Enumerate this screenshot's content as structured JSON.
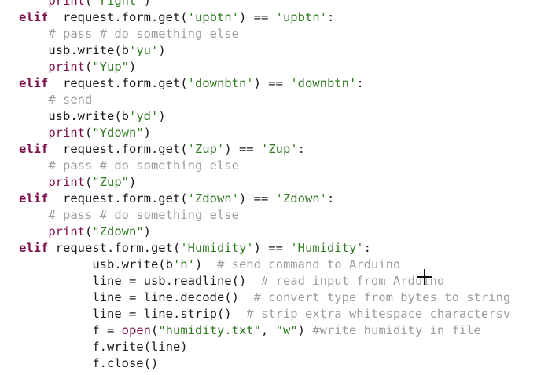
{
  "editor": {
    "lines": [
      {
        "segments": [
          {
            "t": "    "
          },
          {
            "t": "print",
            "c": "bi"
          },
          {
            "t": "("
          },
          {
            "t": "\"right\"",
            "c": "str"
          },
          {
            "t": ")"
          }
        ]
      },
      {
        "segments": [
          {
            "t": "elif",
            "c": "kw"
          },
          {
            "t": "  request.form.get("
          },
          {
            "t": "'upbtn'",
            "c": "str"
          },
          {
            "t": ") == "
          },
          {
            "t": "'upbtn'",
            "c": "str"
          },
          {
            "t": ":"
          }
        ]
      },
      {
        "segments": [
          {
            "t": "    "
          },
          {
            "t": "# pass # do something else",
            "c": "cm"
          }
        ]
      },
      {
        "segments": [
          {
            "t": "    usb.write(b"
          },
          {
            "t": "'yu'",
            "c": "str"
          },
          {
            "t": ")"
          }
        ]
      },
      {
        "segments": [
          {
            "t": "    "
          },
          {
            "t": "print",
            "c": "bi"
          },
          {
            "t": "("
          },
          {
            "t": "\"Yup\"",
            "c": "str"
          },
          {
            "t": ")"
          }
        ]
      },
      {
        "segments": [
          {
            "t": "elif",
            "c": "kw"
          },
          {
            "t": "  request.form.get("
          },
          {
            "t": "'downbtn'",
            "c": "str"
          },
          {
            "t": ") == "
          },
          {
            "t": "'downbtn'",
            "c": "str"
          },
          {
            "t": ":"
          }
        ]
      },
      {
        "segments": [
          {
            "t": "    "
          },
          {
            "t": "# send",
            "c": "cm"
          }
        ]
      },
      {
        "segments": [
          {
            "t": "    usb.write(b"
          },
          {
            "t": "'yd'",
            "c": "str"
          },
          {
            "t": ")"
          }
        ]
      },
      {
        "segments": [
          {
            "t": "    "
          },
          {
            "t": "print",
            "c": "bi"
          },
          {
            "t": "("
          },
          {
            "t": "\"Ydown\"",
            "c": "str"
          },
          {
            "t": ")"
          }
        ]
      },
      {
        "segments": [
          {
            "t": "elif",
            "c": "kw"
          },
          {
            "t": "  request.form.get("
          },
          {
            "t": "'Zup'",
            "c": "str"
          },
          {
            "t": ") == "
          },
          {
            "t": "'Zup'",
            "c": "str"
          },
          {
            "t": ":"
          }
        ]
      },
      {
        "segments": [
          {
            "t": "    "
          },
          {
            "t": "# pass # do something else",
            "c": "cm"
          }
        ]
      },
      {
        "segments": [
          {
            "t": "    "
          },
          {
            "t": "print",
            "c": "bi"
          },
          {
            "t": "("
          },
          {
            "t": "\"Zup\"",
            "c": "str"
          },
          {
            "t": ")"
          }
        ]
      },
      {
        "segments": [
          {
            "t": "elif",
            "c": "kw"
          },
          {
            "t": "  request.form.get("
          },
          {
            "t": "'Zdown'",
            "c": "str"
          },
          {
            "t": ") == "
          },
          {
            "t": "'Zdown'",
            "c": "str"
          },
          {
            "t": ":"
          }
        ]
      },
      {
        "segments": [
          {
            "t": "    "
          },
          {
            "t": "# pass # do something else",
            "c": "cm"
          }
        ]
      },
      {
        "segments": [
          {
            "t": "    "
          },
          {
            "t": "print",
            "c": "bi"
          },
          {
            "t": "("
          },
          {
            "t": "\"Zdown\"",
            "c": "str"
          },
          {
            "t": ")"
          }
        ]
      },
      {
        "segments": [
          {
            "t": "elif",
            "c": "kw"
          },
          {
            "t": " request.form.get("
          },
          {
            "t": "'Humidity'",
            "c": "str"
          },
          {
            "t": ") == "
          },
          {
            "t": "'Humidity'",
            "c": "str"
          },
          {
            "t": ":"
          }
        ]
      },
      {
        "segments": [
          {
            "t": "          usb.write(b"
          },
          {
            "t": "'h'",
            "c": "str"
          },
          {
            "t": ")  "
          },
          {
            "t": "# send command to Arduino",
            "c": "cm"
          }
        ]
      },
      {
        "segments": [
          {
            "t": "          line = usb.readline()  "
          },
          {
            "t": "# read input from Arduino",
            "c": "cm"
          }
        ]
      },
      {
        "segments": [
          {
            "t": "          line = line.decode()  "
          },
          {
            "t": "# convert type from bytes to string",
            "c": "cm"
          }
        ]
      },
      {
        "segments": [
          {
            "t": "          line = line.strip()  "
          },
          {
            "t": "# strip extra whitespace charactersv",
            "c": "cm"
          }
        ]
      },
      {
        "segments": [
          {
            "t": "          f = "
          },
          {
            "t": "open",
            "c": "bi"
          },
          {
            "t": "("
          },
          {
            "t": "\"humidity.txt\"",
            "c": "str"
          },
          {
            "t": ", "
          },
          {
            "t": "\"w\"",
            "c": "str"
          },
          {
            "t": ") "
          },
          {
            "t": "#write humidity in file",
            "c": "cm"
          }
        ]
      },
      {
        "segments": [
          {
            "t": "          f.write(line)"
          }
        ]
      },
      {
        "segments": [
          {
            "t": "          f.close()"
          }
        ]
      }
    ]
  }
}
